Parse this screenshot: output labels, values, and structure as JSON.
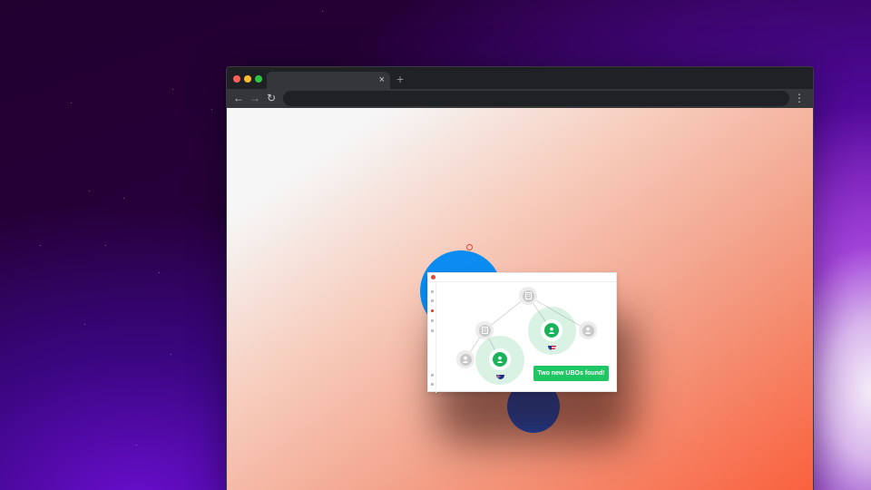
{
  "browser": {
    "tab_close_glyph": "×",
    "new_tab_glyph": "+",
    "back_glyph": "←",
    "forward_glyph": "→",
    "reload_glyph": "↻",
    "menu_glyph": "⋮",
    "address": ""
  },
  "card": {
    "breadcrumb_left": "",
    "breadcrumb_right": "",
    "toast_label": "Two new UBOs found!"
  },
  "colors": {
    "accent_green": "#1fc764",
    "blob_blue": "#0a8cf0",
    "blob_navy": "#1f4fc4",
    "brand_red": "#e0482f"
  }
}
